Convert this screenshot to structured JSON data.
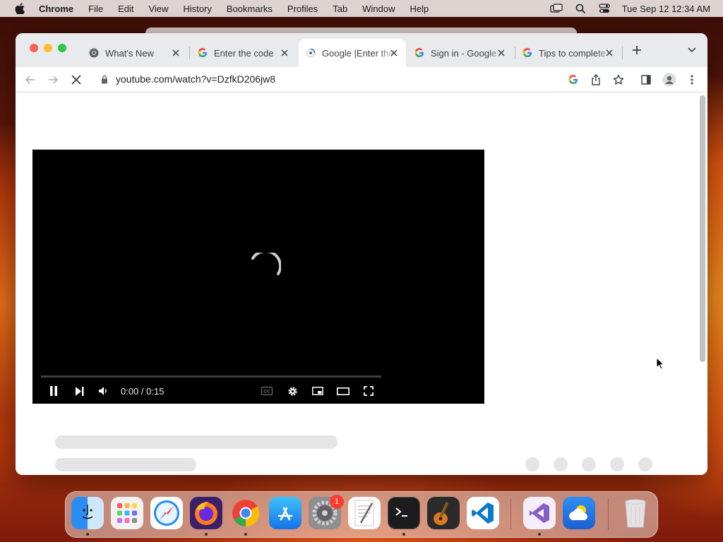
{
  "menubar": {
    "app_name": "Chrome",
    "menus": [
      "File",
      "Edit",
      "View",
      "History",
      "Bookmarks",
      "Profiles",
      "Tab",
      "Window",
      "Help"
    ],
    "clock": "Tue Sep 12  12:34 AM"
  },
  "tabs": [
    {
      "title": "What's New",
      "favicon": "chrome-icon",
      "active": false
    },
    {
      "title": "Enter the code",
      "favicon": "google-icon",
      "active": false
    },
    {
      "title": "Google |Enter the code",
      "favicon": "loading-icon",
      "active": true
    },
    {
      "title": "Sign in - Google",
      "favicon": "google-icon",
      "active": false
    },
    {
      "title": "Tips to complete",
      "favicon": "google-icon",
      "active": false
    }
  ],
  "toolbar": {
    "url": "youtube.com/watch?v=DzfkD206jw8"
  },
  "player": {
    "time": "0:00 / 0:15",
    "loading": true
  },
  "dock": {
    "apps": [
      "Finder",
      "Launchpad",
      "Safari",
      "Firefox",
      "Chrome",
      "App Store",
      "System Settings",
      "TextEdit",
      "Terminal",
      "GarageBand",
      "Visual Studio Code",
      "Visual Studio",
      "Weather",
      "Trash"
    ],
    "settings_badge": "1"
  },
  "colors": {
    "tab_strip": "#e8eaed",
    "player_bg": "#000000",
    "skeleton": "#e5e5e5",
    "close_red": "#ff5f57",
    "minimize_yellow": "#febc2e",
    "zoom_green": "#28c840"
  }
}
